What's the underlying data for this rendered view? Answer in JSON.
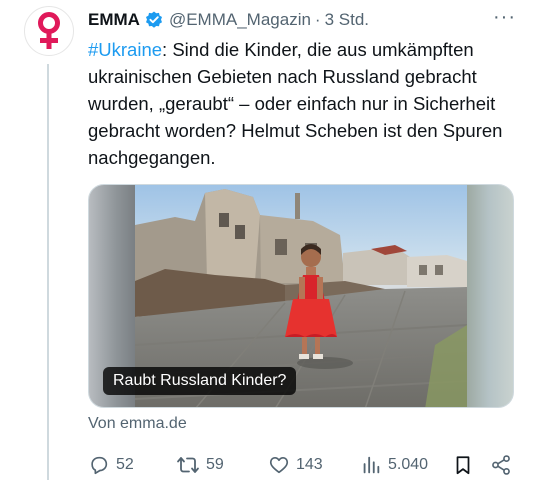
{
  "tweet": {
    "author_name": "EMMA",
    "handle": "@EMMA_Magazin",
    "separator": "·",
    "time": "3 Std.",
    "more_label": "···",
    "hashtag": "#Ukraine",
    "body": ": Sind die Kinder, die aus umkämpften ukrainischen Gebieten nach Russland gebracht wurden, „geraubt“ – oder einfach nur in Sicherheit gebracht worden? Helmut Scheben ist den Spuren nachgegangen.",
    "card_title": "Raubt Russland Kinder?",
    "source": "Von emma.de"
  },
  "actions": {
    "replies": "52",
    "retweets": "59",
    "likes": "143",
    "views": "5.040"
  },
  "icons": {
    "avatar": "venus-symbol-icon",
    "verified": "verified-badge-icon",
    "reply": "reply-icon",
    "retweet": "retweet-icon",
    "like": "heart-icon",
    "views": "views-icon",
    "bookmark": "bookmark-icon",
    "share": "share-icon"
  },
  "colors": {
    "brand": "#e0195a",
    "link": "#1d9bf0",
    "muted": "#536471"
  }
}
